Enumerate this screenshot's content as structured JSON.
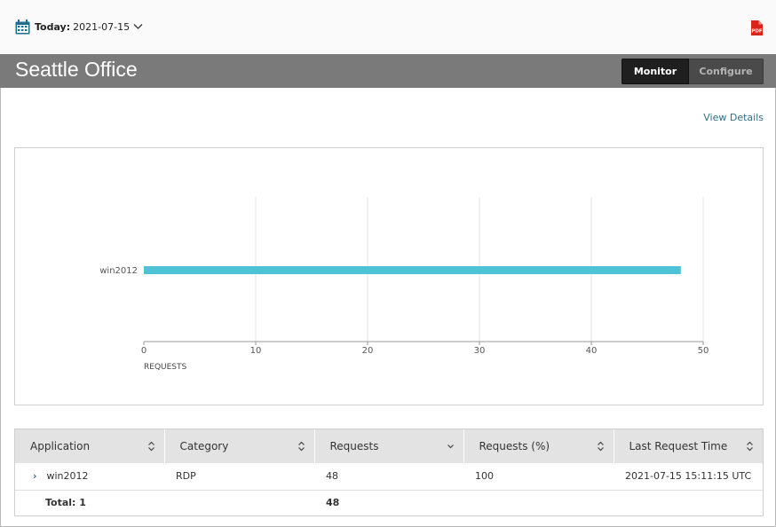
{
  "header": {
    "date_label": "Today:",
    "date_value": "2021-07-15",
    "calendar_color": "#1d6f8c",
    "pdf_icon": "pdf-icon",
    "pdf_text": "PDF"
  },
  "titlebar": {
    "title": "Seattle Office",
    "tabs": [
      {
        "label": "Monitor",
        "active": true
      },
      {
        "label": "Configure",
        "active": false
      }
    ]
  },
  "view_details_label": "View Details",
  "chart_data": {
    "type": "bar",
    "orientation": "horizontal",
    "categories": [
      "win2012"
    ],
    "values": [
      48
    ],
    "xlabel": "REQUESTS",
    "xlim": [
      0,
      50
    ],
    "xticks": [
      0,
      10,
      20,
      30,
      40,
      50
    ],
    "grid": true,
    "bar_color": "#4fc3d6"
  },
  "table": {
    "columns": [
      {
        "label": "Application",
        "sort": "both"
      },
      {
        "label": "Category",
        "sort": "both"
      },
      {
        "label": "Requests",
        "sort": "desc"
      },
      {
        "label": "Requests (%)",
        "sort": "both"
      },
      {
        "label": "Last Request Time",
        "sort": "both"
      }
    ],
    "rows": [
      {
        "expander": "›",
        "application": "win2012",
        "category": "RDP",
        "requests": "48",
        "requests_pct": "100",
        "last_request": "2021-07-15 15:11:15 UTC"
      }
    ],
    "total": {
      "label": "Total: 1",
      "requests": "48"
    }
  }
}
